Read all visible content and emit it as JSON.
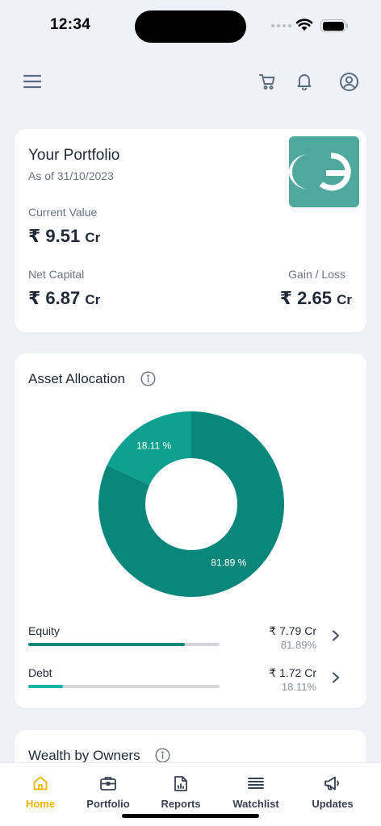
{
  "status_bar": {
    "time": "12:34"
  },
  "portfolio": {
    "title": "Your Portfolio",
    "as_of": "As of 31/10/2023",
    "current_value_label": "Current Value",
    "current_value": "₹ 9.51",
    "current_value_unit": "Cr",
    "net_capital_label": "Net Capital",
    "net_capital": "₹ 6.87",
    "net_capital_unit": "Cr",
    "gain_loss_label": "Gain / Loss",
    "gain_loss": "₹ 2.65",
    "gain_loss_unit": "Cr"
  },
  "allocation": {
    "title": "Asset Allocation",
    "chart_data": {
      "type": "pie",
      "categories": [
        "Equity",
        "Debt"
      ],
      "values": [
        81.89,
        18.11
      ],
      "labels": [
        "81.89 %",
        "18.11 %"
      ],
      "colors": [
        "#0a877a",
        "#0da08f"
      ]
    },
    "rows": [
      {
        "name": "Equity",
        "amount": "₹ 7.79 Cr",
        "percent": "81.89%",
        "fraction": 0.8189,
        "color": "#0a877a"
      },
      {
        "name": "Debt",
        "amount": "₹ 1.72 Cr",
        "percent": "18.11%",
        "fraction": 0.1811,
        "color": "#12b3a4"
      }
    ]
  },
  "owners": {
    "title": "Wealth by Owners"
  },
  "tabs": [
    {
      "label": "Home",
      "icon": "home-icon",
      "active": true
    },
    {
      "label": "Portfolio",
      "icon": "briefcase-icon",
      "active": false
    },
    {
      "label": "Reports",
      "icon": "report-icon",
      "active": false
    },
    {
      "label": "Watchlist",
      "icon": "list-icon",
      "active": false
    },
    {
      "label": "Updates",
      "icon": "megaphone-icon",
      "active": false
    }
  ],
  "colors": {
    "accent": "#f0b400",
    "brand": "#4ea89d",
    "equity": "#0a877a",
    "debt": "#0da08f"
  }
}
